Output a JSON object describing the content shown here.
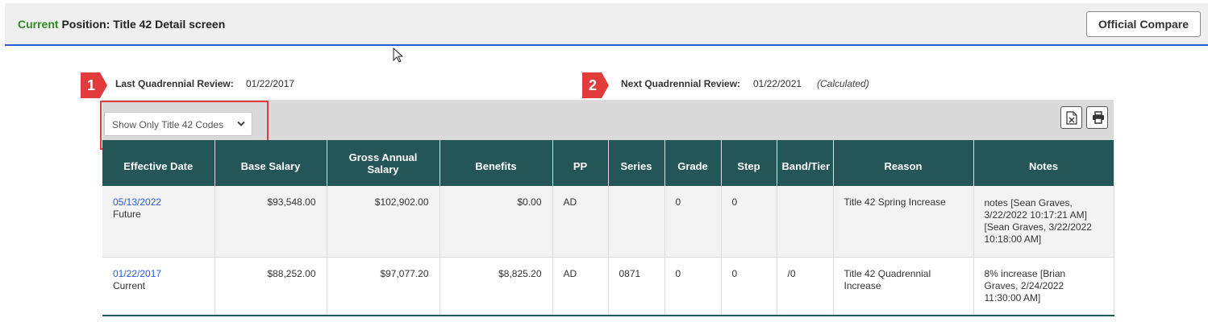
{
  "header": {
    "title_prefix": "Current",
    "title_rest": " Position: Title 42 Detail screen",
    "compare_button": "Official Compare"
  },
  "review": {
    "badge1": "1",
    "badge2": "2",
    "last_label": "Last Quadrennial Review:",
    "last_value": "01/22/2017",
    "next_label": "Next Quadrennial Review:",
    "next_value": "01/22/2021",
    "next_note": "(Calculated)"
  },
  "filter": {
    "selected": "Show Only Title 42 Codes"
  },
  "icons": {
    "export": "excel-export-icon",
    "print": "printer-icon"
  },
  "colors": {
    "accent_green": "#2f8a1f",
    "header_rule": "#2a5bd7",
    "table_header": "#245657",
    "badge": "#e23b3b",
    "link": "#2a5bd7"
  },
  "table": {
    "columns": [
      [
        "Effective Date"
      ],
      [
        "Base Salary"
      ],
      [
        "Gross Annual",
        "Salary"
      ],
      [
        "Benefits"
      ],
      [
        "PP"
      ],
      [
        "Series"
      ],
      [
        "Grade"
      ],
      [
        "Step"
      ],
      [
        "Band/Tier"
      ],
      [
        "Reason"
      ],
      [
        "Notes"
      ]
    ],
    "rows": [
      {
        "date": "05/13/2022",
        "status": "Future",
        "base": "$93,548.00",
        "gross": "$102,902.00",
        "benefits": "$0.00",
        "pp": "AD",
        "series": "",
        "grade": "0",
        "step": "0",
        "band": "",
        "reason": [
          "Title 42 Spring Increase"
        ],
        "notes": [
          "notes [Sean Graves,",
          "3/22/2022 10:17:21 AM]",
          "[Sean Graves, 3/22/2022",
          "10:18:00 AM]"
        ]
      },
      {
        "date": "01/22/2017",
        "status": "Current",
        "base": "$88,252.00",
        "gross": "$97,077.20",
        "benefits": "$8,825.20",
        "pp": "AD",
        "series": "0871",
        "grade": "0",
        "step": "0",
        "band": "/0",
        "reason": [
          "Title 42 Quadrennial",
          "Increase"
        ],
        "notes": [
          "8% increase [Brian",
          "Graves, 2/24/2022",
          "11:30:00 AM]"
        ]
      }
    ]
  }
}
